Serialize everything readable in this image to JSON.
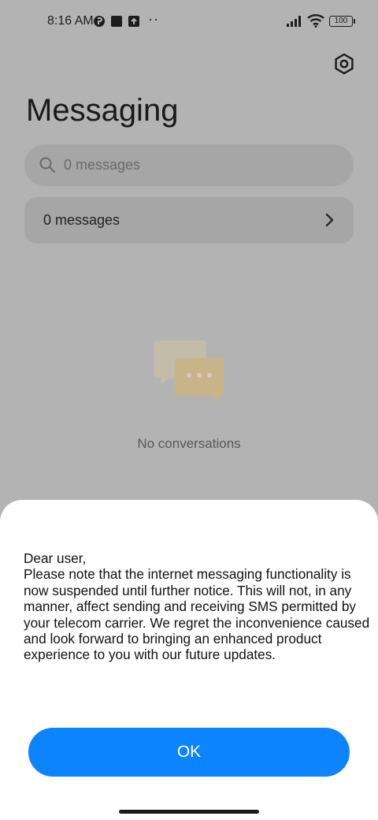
{
  "status_bar": {
    "time": "8:16 AM",
    "dots": "··",
    "battery": "100"
  },
  "header": {
    "title": "Messaging"
  },
  "search": {
    "placeholder": "0 messages"
  },
  "messages_row": {
    "label": "0 messages"
  },
  "empty_state": {
    "text": "No conversations"
  },
  "dialog": {
    "greeting": "Dear user,",
    "body": "Please note that the internet messaging functionality is now suspended until further notice. This will not, in any manner, affect sending and receiving SMS permitted by your telecom carrier. We regret the inconvenience caused and look forward to bringing an enhanced product experience to you with our future updates.",
    "ok_label": "OK"
  },
  "colors": {
    "accent": "#0d84ff",
    "dim_background": "#b3b3b3"
  }
}
